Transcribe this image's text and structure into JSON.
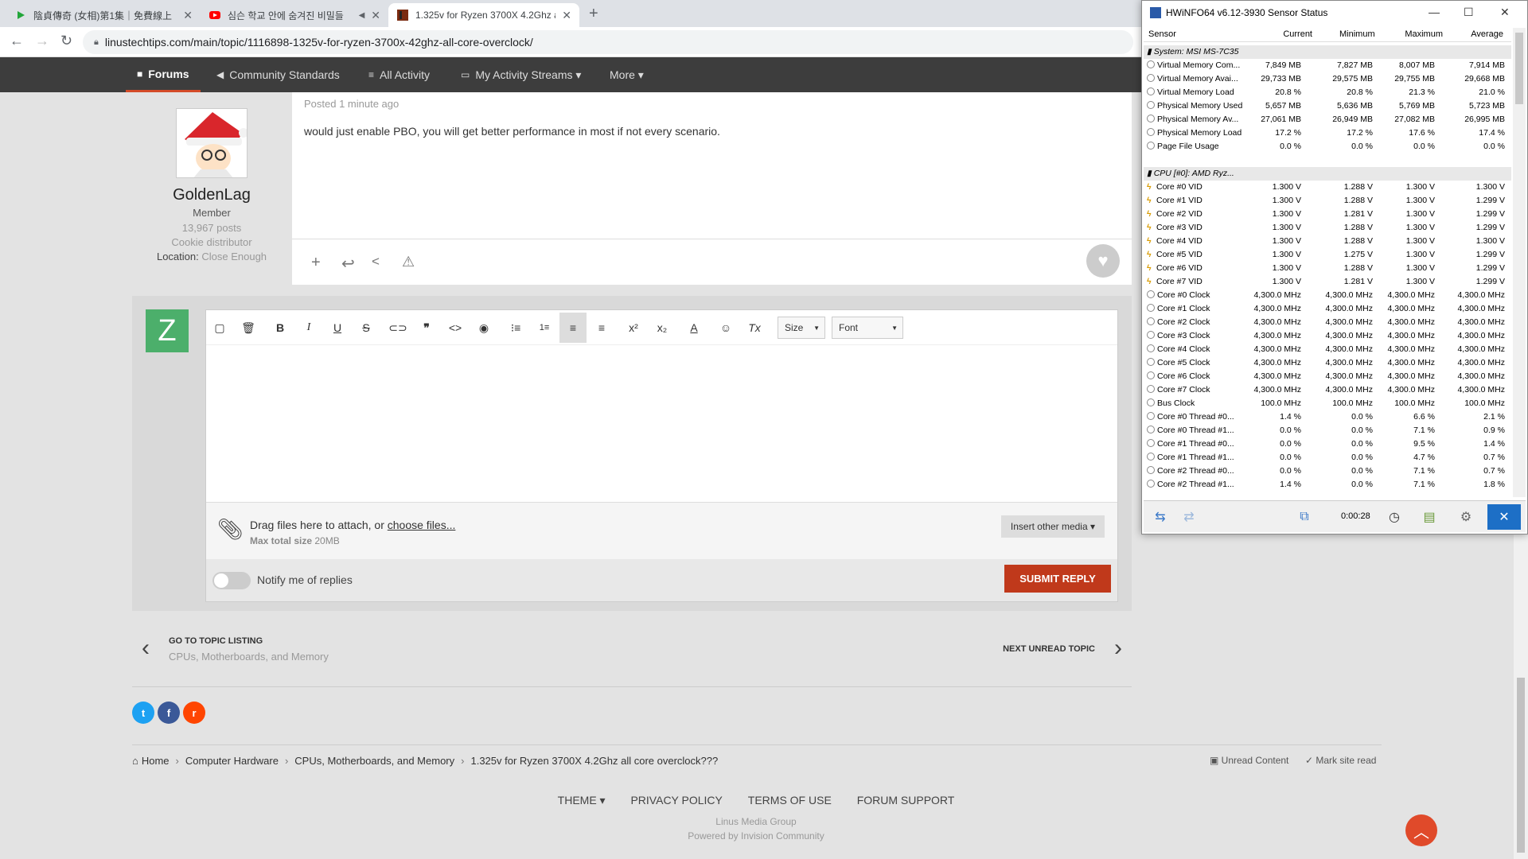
{
  "browser": {
    "tabs": [
      {
        "title": "陰貞傳奇 (女相)第1集｜免費線上",
        "icon": "play-icon",
        "color": "#22a63a"
      },
      {
        "title": "심슨 학교 안에 숨겨진 비밀들",
        "icon": "youtube-icon",
        "color": "#ff0000"
      },
      {
        "title": "1.325v for Ryzen 3700X 4.2Ghz a",
        "icon": "ltt-icon",
        "color": "#7a2a10"
      }
    ],
    "url": "linustechtips.com/main/topic/1116898-1325v-for-ryzen-3700x-42ghz-all-core-overclock/"
  },
  "forum_nav": {
    "items": [
      {
        "label": "Forums",
        "icon": "comments-icon"
      },
      {
        "label": "Community Standards",
        "icon": "megaphone-icon"
      },
      {
        "label": "All Activity",
        "icon": "list-icon"
      },
      {
        "label": "My Activity Streams ▾",
        "icon": "stream-icon"
      },
      {
        "label": "More ▾",
        "icon": ""
      }
    ]
  },
  "post": {
    "author": {
      "name": "GoldenLag",
      "rank": "Member",
      "posts": "13,967 posts",
      "title": "Cookie distributor",
      "location_label": "Location:",
      "location": "Close Enough"
    },
    "meta": "Posted 1 minute ago",
    "body": "would just enable PBO, you will get better performance in most if not every scenario."
  },
  "reply": {
    "avatar_letter": "Z",
    "size_label": "Size",
    "font_label": "Font",
    "attach_text": "Drag files here to attach, or ",
    "attach_link": "choose files...",
    "max_label": "Max total size",
    "max_value": "20MB",
    "insert_media": "Insert other media ▾",
    "notify": "Notify me of replies",
    "submit": "SUBMIT REPLY"
  },
  "pager": {
    "back_title": "GO TO TOPIC LISTING",
    "back_sub": "CPUs, Motherboards, and Memory",
    "next": "NEXT UNREAD TOPIC"
  },
  "breadcrumb": {
    "items": [
      "Home",
      "Computer Hardware",
      "CPUs, Motherboards, and Memory",
      "1.325v for Ryzen 3700X 4.2Ghz all core overclock???"
    ],
    "unread": "Unread Content",
    "mark_read": "Mark site read"
  },
  "footer": {
    "menu": [
      "THEME ▾",
      "PRIVACY POLICY",
      "TERMS OF USE",
      "FORUM SUPPORT"
    ],
    "company": "Linus Media Group",
    "powered": "Powered by Invision Community"
  },
  "hwinfo": {
    "title": "HWiNFO64 v6.12-3930 Sensor Status",
    "columns": [
      "Sensor",
      "Current",
      "Minimum",
      "Maximum",
      "Average"
    ],
    "elapsed": "0:00:28",
    "rows": [
      {
        "type": "group",
        "name": "System: MSI MS-7C35"
      },
      {
        "name": "Virtual Memory Com...",
        "vals": [
          "7,849 MB",
          "7,827 MB",
          "8,007 MB",
          "7,914 MB"
        ]
      },
      {
        "name": "Virtual Memory Avai...",
        "vals": [
          "29,733 MB",
          "29,575 MB",
          "29,755 MB",
          "29,668 MB"
        ]
      },
      {
        "name": "Virtual Memory Load",
        "vals": [
          "20.8 %",
          "20.8 %",
          "21.3 %",
          "21.0 %"
        ]
      },
      {
        "name": "Physical Memory Used",
        "vals": [
          "5,657 MB",
          "5,636 MB",
          "5,769 MB",
          "5,723 MB"
        ]
      },
      {
        "name": "Physical Memory Av...",
        "vals": [
          "27,061 MB",
          "26,949 MB",
          "27,082 MB",
          "26,995 MB"
        ]
      },
      {
        "name": "Physical Memory Load",
        "vals": [
          "17.2 %",
          "17.2 %",
          "17.6 %",
          "17.4 %"
        ]
      },
      {
        "name": "Page File Usage",
        "vals": [
          "0.0 %",
          "0.0 %",
          "0.0 %",
          "0.0 %"
        ]
      },
      {
        "type": "blank"
      },
      {
        "type": "group",
        "name": "CPU [#0]: AMD Ryz..."
      },
      {
        "v": 1,
        "name": "Core #0 VID",
        "vals": [
          "1.300 V",
          "1.288 V",
          "1.300 V",
          "1.300 V"
        ]
      },
      {
        "v": 1,
        "name": "Core #1 VID",
        "vals": [
          "1.300 V",
          "1.288 V",
          "1.300 V",
          "1.299 V"
        ]
      },
      {
        "v": 1,
        "name": "Core #2 VID",
        "vals": [
          "1.300 V",
          "1.281 V",
          "1.300 V",
          "1.299 V"
        ]
      },
      {
        "v": 1,
        "name": "Core #3 VID",
        "vals": [
          "1.300 V",
          "1.288 V",
          "1.300 V",
          "1.299 V"
        ]
      },
      {
        "v": 1,
        "name": "Core #4 VID",
        "vals": [
          "1.300 V",
          "1.288 V",
          "1.300 V",
          "1.300 V"
        ]
      },
      {
        "v": 1,
        "name": "Core #5 VID",
        "vals": [
          "1.300 V",
          "1.275 V",
          "1.300 V",
          "1.299 V"
        ]
      },
      {
        "v": 1,
        "name": "Core #6 VID",
        "vals": [
          "1.300 V",
          "1.288 V",
          "1.300 V",
          "1.299 V"
        ]
      },
      {
        "v": 1,
        "name": "Core #7 VID",
        "vals": [
          "1.300 V",
          "1.281 V",
          "1.300 V",
          "1.299 V"
        ]
      },
      {
        "name": "Core #0 Clock",
        "vals": [
          "4,300.0 MHz",
          "4,300.0 MHz",
          "4,300.0 MHz",
          "4,300.0 MHz"
        ]
      },
      {
        "name": "Core #1 Clock",
        "vals": [
          "4,300.0 MHz",
          "4,300.0 MHz",
          "4,300.0 MHz",
          "4,300.0 MHz"
        ]
      },
      {
        "name": "Core #2 Clock",
        "vals": [
          "4,300.0 MHz",
          "4,300.0 MHz",
          "4,300.0 MHz",
          "4,300.0 MHz"
        ]
      },
      {
        "name": "Core #3 Clock",
        "vals": [
          "4,300.0 MHz",
          "4,300.0 MHz",
          "4,300.0 MHz",
          "4,300.0 MHz"
        ]
      },
      {
        "name": "Core #4 Clock",
        "vals": [
          "4,300.0 MHz",
          "4,300.0 MHz",
          "4,300.0 MHz",
          "4,300.0 MHz"
        ]
      },
      {
        "name": "Core #5 Clock",
        "vals": [
          "4,300.0 MHz",
          "4,300.0 MHz",
          "4,300.0 MHz",
          "4,300.0 MHz"
        ]
      },
      {
        "name": "Core #6 Clock",
        "vals": [
          "4,300.0 MHz",
          "4,300.0 MHz",
          "4,300.0 MHz",
          "4,300.0 MHz"
        ]
      },
      {
        "name": "Core #7 Clock",
        "vals": [
          "4,300.0 MHz",
          "4,300.0 MHz",
          "4,300.0 MHz",
          "4,300.0 MHz"
        ]
      },
      {
        "name": "Bus Clock",
        "vals": [
          "100.0 MHz",
          "100.0 MHz",
          "100.0 MHz",
          "100.0 MHz"
        ]
      },
      {
        "name": "Core #0 Thread #0...",
        "vals": [
          "1.4 %",
          "0.0 %",
          "6.6 %",
          "2.1 %"
        ]
      },
      {
        "name": "Core #0 Thread #1...",
        "vals": [
          "0.0 %",
          "0.0 %",
          "7.1 %",
          "0.9 %"
        ]
      },
      {
        "name": "Core #1 Thread #0...",
        "vals": [
          "0.0 %",
          "0.0 %",
          "9.5 %",
          "1.4 %"
        ]
      },
      {
        "name": "Core #1 Thread #1...",
        "vals": [
          "0.0 %",
          "0.0 %",
          "4.7 %",
          "0.7 %"
        ]
      },
      {
        "name": "Core #2 Thread #0...",
        "vals": [
          "0.0 %",
          "0.0 %",
          "7.1 %",
          "0.7 %"
        ]
      },
      {
        "name": "Core #2 Thread #1...",
        "vals": [
          "1.4 %",
          "0.0 %",
          "7.1 %",
          "1.8 %"
        ]
      }
    ]
  }
}
